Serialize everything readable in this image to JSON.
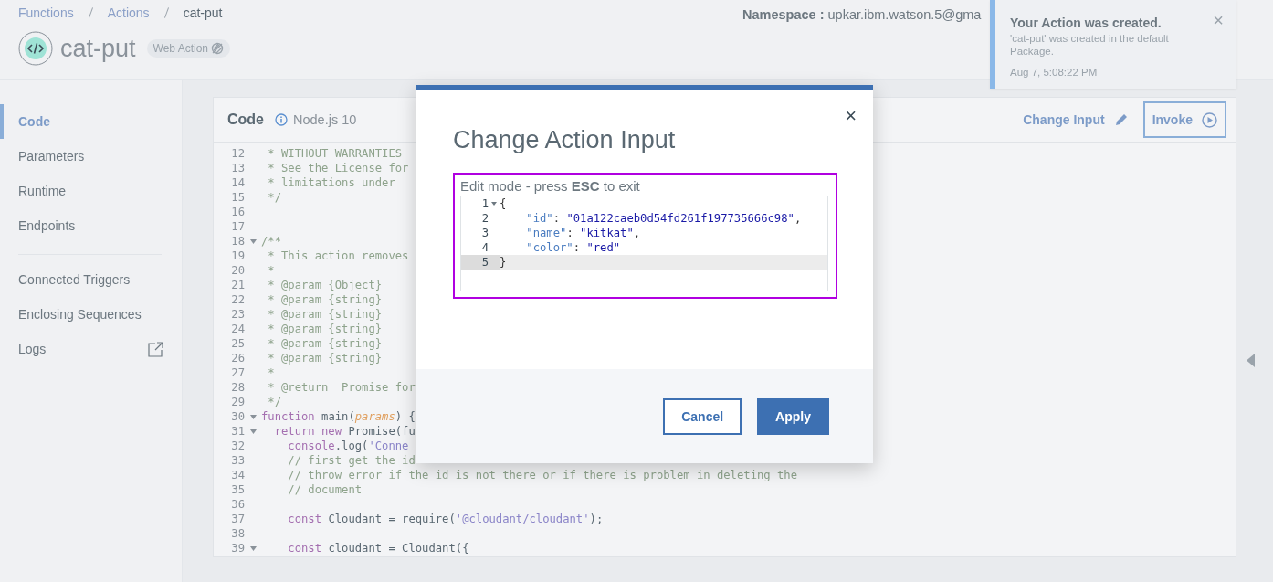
{
  "breadcrumbs": [
    {
      "label": "Functions",
      "current": false
    },
    {
      "label": "Actions",
      "current": false
    },
    {
      "label": "cat-put",
      "current": true
    }
  ],
  "action": {
    "name": "cat-put",
    "badge": "Web Action"
  },
  "namespace": "**Namespace :** upkar.ibm.watson.5@gma",
  "notification": {
    "title": "Your Action was created.",
    "message": "'cat-put' was created in the default Package.",
    "time": "Aug 7, 5:08:22 PM",
    "close": "×"
  },
  "sidebar": {
    "groups": [
      [
        {
          "label": "Code",
          "selected": true,
          "external": false
        },
        {
          "label": "Parameters",
          "selected": false,
          "external": false
        },
        {
          "label": "Runtime",
          "selected": false,
          "external": false
        },
        {
          "label": "Endpoints",
          "selected": false,
          "external": false
        }
      ],
      [
        {
          "label": "Connected Triggers",
          "selected": false,
          "external": false
        },
        {
          "label": "Enclosing Sequences",
          "selected": false,
          "external": false
        },
        {
          "label": "Logs",
          "selected": false,
          "external": true
        }
      ]
    ]
  },
  "code_panel": {
    "title": "Code",
    "runtime": "Node.js 10",
    "change_input": "Change Input",
    "invoke": "Invoke",
    "lines": [
      {
        "num": "12",
        "fold": false,
        "segments": [
          {
            "kind": "comment",
            "text": " * WITHOUT WARRANTIES"
          }
        ]
      },
      {
        "num": "13",
        "fold": false,
        "segments": [
          {
            "kind": "comment",
            "text": " * See the License for"
          }
        ]
      },
      {
        "num": "14",
        "fold": false,
        "segments": [
          {
            "kind": "comment",
            "text": " * limitations under"
          }
        ]
      },
      {
        "num": "15",
        "fold": false,
        "segments": [
          {
            "kind": "comment",
            "text": " */"
          }
        ]
      },
      {
        "num": "16",
        "fold": false
      },
      {
        "num": "17",
        "fold": false
      },
      {
        "num": "18",
        "fold": true,
        "segments": [
          {
            "kind": "comment",
            "text": "/**"
          }
        ]
      },
      {
        "num": "19",
        "fold": false,
        "segments": [
          {
            "kind": "comment",
            "text": " * This action removes"
          }
        ]
      },
      {
        "num": "20",
        "fold": false,
        "segments": [
          {
            "kind": "comment",
            "text": " *"
          }
        ]
      },
      {
        "num": "21",
        "fold": false,
        "segments": [
          {
            "kind": "comment",
            "text": " * @param {Object}"
          }
        ]
      },
      {
        "num": "22",
        "fold": false,
        "segments": [
          {
            "kind": "comment",
            "text": " * @param {string}"
          }
        ]
      },
      {
        "num": "23",
        "fold": false,
        "segments": [
          {
            "kind": "comment",
            "text": " * @param {string}"
          }
        ]
      },
      {
        "num": "24",
        "fold": false,
        "segments": [
          {
            "kind": "comment",
            "text": " * @param {string}"
          }
        ]
      },
      {
        "num": "25",
        "fold": false,
        "segments": [
          {
            "kind": "comment",
            "text": " * @param {string}"
          }
        ]
      },
      {
        "num": "26",
        "fold": false,
        "segments": [
          {
            "kind": "comment",
            "text": " * @param {string}"
          }
        ]
      },
      {
        "num": "27",
        "fold": false,
        "segments": [
          {
            "kind": "comment",
            "text": " *"
          }
        ]
      },
      {
        "num": "28",
        "fold": false,
        "segments": [
          {
            "kind": "comment",
            "text": " * @return  Promise for"
          }
        ]
      },
      {
        "num": "29",
        "fold": false,
        "segments": [
          {
            "kind": "comment",
            "text": " */"
          }
        ]
      },
      {
        "num": "30",
        "fold": true,
        "segments": [
          {
            "kind": "keyword",
            "text": "function"
          },
          {
            "kind": "plain",
            "text": " main("
          },
          {
            "kind": "param",
            "text": "params"
          },
          {
            "kind": "plain",
            "text": ") {"
          }
        ]
      },
      {
        "num": "31",
        "fold": true,
        "segments": [
          {
            "kind": "keyword",
            "text": "  return new"
          },
          {
            "kind": "plain",
            "text": " Promise(fu"
          }
        ]
      },
      {
        "num": "32",
        "fold": false,
        "segments": [
          {
            "kind": "keyword",
            "text": "    console"
          },
          {
            "kind": "plain",
            "text": ".log("
          },
          {
            "kind": "string",
            "text": "'Conne"
          }
        ]
      },
      {
        "num": "33",
        "fold": false,
        "segments": [
          {
            "kind": "comment",
            "text": "    // first get the id"
          }
        ]
      },
      {
        "num": "34",
        "fold": false,
        "segments": [
          {
            "kind": "comment",
            "text": "    // throw error if the id is not there or if there is problem in deleting the"
          }
        ]
      },
      {
        "num": "35",
        "fold": false,
        "segments": [
          {
            "kind": "comment",
            "text": "    // document"
          }
        ]
      },
      {
        "num": "36",
        "fold": false
      },
      {
        "num": "37",
        "fold": false,
        "segments": [
          {
            "kind": "keyword",
            "text": "    const"
          },
          {
            "kind": "plain",
            "text": " Cloudant = require("
          },
          {
            "kind": "string",
            "text": "'@cloudant/cloudant'"
          },
          {
            "kind": "plain",
            "text": ");"
          }
        ]
      },
      {
        "num": "38",
        "fold": false
      },
      {
        "num": "39",
        "fold": true,
        "segments": [
          {
            "kind": "keyword",
            "text": "    const"
          },
          {
            "kind": "plain",
            "text": " cloudant = Cloudant({"
          }
        ]
      }
    ]
  },
  "modal": {
    "title": "Change Action Input",
    "close": "×",
    "hint": "Edit mode - press **ESC** to exit",
    "editor_lines": [
      {
        "num": "1",
        "fold": true,
        "active": false,
        "segments": [
          {
            "kind": "punct",
            "text": "{"
          }
        ]
      },
      {
        "num": "2",
        "fold": false,
        "active": false,
        "segments": [
          {
            "kind": "key",
            "text": "    \"id\""
          },
          {
            "kind": "punct",
            "text": ": "
          },
          {
            "kind": "value",
            "text": "\"01a122caeb0d54fd261f197735666c98\""
          },
          {
            "kind": "punct",
            "text": ","
          }
        ]
      },
      {
        "num": "3",
        "fold": false,
        "active": false,
        "segments": [
          {
            "kind": "key",
            "text": "    \"name\""
          },
          {
            "kind": "punct",
            "text": ": "
          },
          {
            "kind": "value",
            "text": "\"kitkat\""
          },
          {
            "kind": "punct",
            "text": ","
          }
        ]
      },
      {
        "num": "4",
        "fold": false,
        "active": false,
        "segments": [
          {
            "kind": "key",
            "text": "    \"color\""
          },
          {
            "kind": "punct",
            "text": ": "
          },
          {
            "kind": "value",
            "text": "\"red\""
          }
        ]
      },
      {
        "num": "5",
        "fold": false,
        "active": true,
        "segments": [
          {
            "kind": "punct",
            "text": "}"
          }
        ]
      }
    ],
    "buttons": [
      {
        "label": "Cancel",
        "kind": "secondary"
      },
      {
        "label": "Apply",
        "kind": "primary"
      }
    ]
  }
}
